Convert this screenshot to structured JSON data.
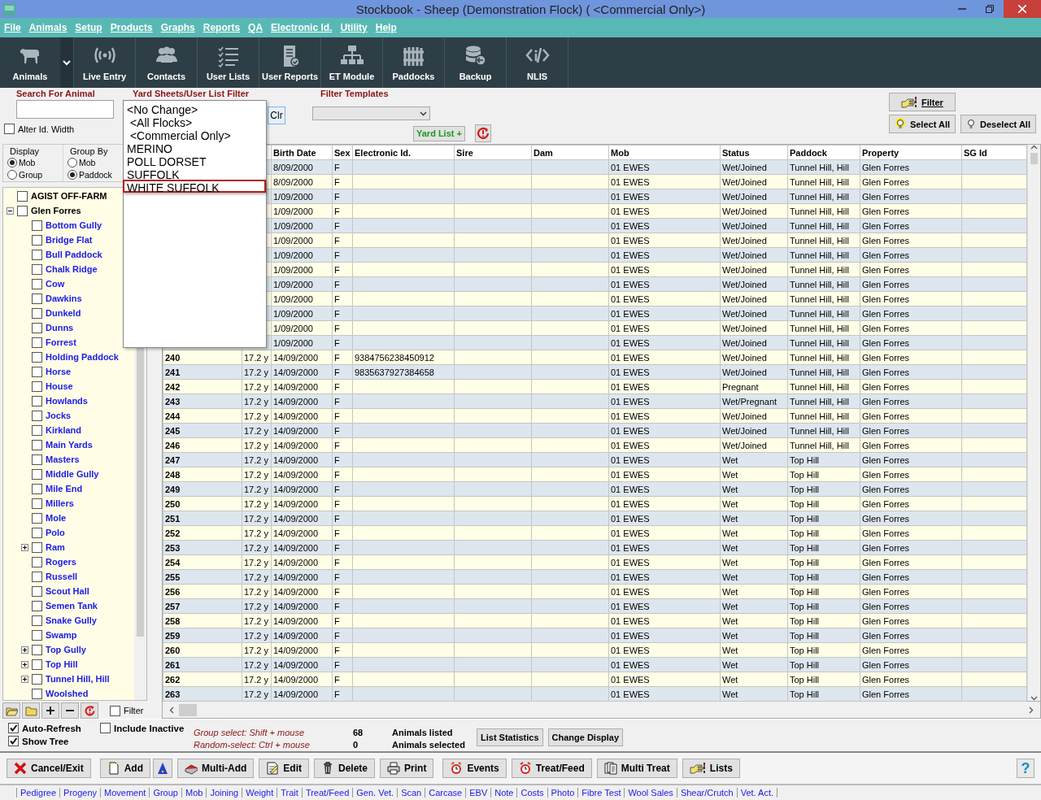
{
  "window": {
    "title": "Stockbook - Sheep (Demonstration Flock) ( <Commercial Only>)"
  },
  "menu": [
    "File",
    "Animals",
    "Setup",
    "Products",
    "Graphs",
    "Reports",
    "QA",
    "Electronic Id.",
    "Utility",
    "Help"
  ],
  "toolbar": [
    {
      "label": "Animals",
      "dropdown": true
    },
    {
      "label": "Live Entry"
    },
    {
      "label": "Contacts"
    },
    {
      "label": "User Lists"
    },
    {
      "label": "User Reports"
    },
    {
      "label": "ET Module"
    },
    {
      "label": "Paddocks"
    },
    {
      "label": "Backup"
    },
    {
      "label": "NLIS"
    }
  ],
  "filters": {
    "search": {
      "label": "Search For Animal"
    },
    "alter_id_width": {
      "label": "Alter Id. Width",
      "checked": false
    },
    "list_filter": {
      "label": "Yard Sheets/User List Filter",
      "clear_button": "Clr",
      "options": [
        {
          "label": "<No Change>",
          "selected": false
        },
        {
          "label": " <All Flocks>",
          "selected": false
        },
        {
          "label": " <Commercial Only>",
          "selected": false
        },
        {
          "label": "MERINO",
          "selected": false
        },
        {
          "label": "POLL DORSET",
          "selected": false
        },
        {
          "label": "SUFFOLK",
          "selected": false
        },
        {
          "label": "WHITE SUFFOLK",
          "selected": true
        }
      ]
    },
    "filter_templates": {
      "label": "Filter Templates"
    },
    "yard_list_button": "Yard List +",
    "filter_button": "Filter",
    "select_all_button": "Select All",
    "deselect_all_button": "Deselect All"
  },
  "display": {
    "label": "Display",
    "options": [
      {
        "label": "Mob",
        "selected": true
      },
      {
        "label": "Group",
        "selected": false
      }
    ]
  },
  "group_by": {
    "label": "Group By",
    "options": [
      {
        "label": "Mob",
        "selected": false
      },
      {
        "label": "Paddock",
        "selected": true
      }
    ]
  },
  "tree": [
    {
      "label": "AGIST OFF-FARM",
      "checked": false
    },
    {
      "label": "Glen Forres",
      "checked": false,
      "expanded": true,
      "children": [
        {
          "label": "Bottom Gully",
          "checked": false
        },
        {
          "label": "Bridge Flat",
          "checked": false
        },
        {
          "label": "Bull Paddock",
          "checked": false
        },
        {
          "label": "Chalk Ridge",
          "checked": false
        },
        {
          "label": "Cow",
          "checked": false
        },
        {
          "label": "Dawkins",
          "checked": false
        },
        {
          "label": "Dunkeld",
          "checked": false
        },
        {
          "label": "Dunns",
          "checked": false
        },
        {
          "label": "Forrest",
          "checked": false
        },
        {
          "label": "Holding Paddock",
          "checked": false
        },
        {
          "label": "Horse",
          "checked": false
        },
        {
          "label": "House",
          "checked": false
        },
        {
          "label": "Howlands",
          "checked": false
        },
        {
          "label": "Jocks",
          "checked": false
        },
        {
          "label": "Kirkland",
          "checked": false
        },
        {
          "label": "Main Yards",
          "checked": false
        },
        {
          "label": "Masters",
          "checked": false
        },
        {
          "label": "Middle Gully",
          "checked": false
        },
        {
          "label": "Mile End",
          "checked": false
        },
        {
          "label": "Millers",
          "checked": false
        },
        {
          "label": "Mole",
          "checked": false
        },
        {
          "label": "Polo",
          "checked": false
        },
        {
          "label": "Ram",
          "checked": false,
          "expanded": false
        },
        {
          "label": "Rogers",
          "checked": false
        },
        {
          "label": "Russell",
          "checked": false
        },
        {
          "label": "Scout Hall",
          "checked": false
        },
        {
          "label": "Semen Tank",
          "checked": false
        },
        {
          "label": "Snake Gully",
          "checked": false
        },
        {
          "label": "Swamp",
          "checked": false
        },
        {
          "label": "Top Gully",
          "checked": false,
          "expanded": false
        },
        {
          "label": "Top Hill",
          "checked": false,
          "expanded": false
        },
        {
          "label": "Tunnel Hill, Hill",
          "checked": false,
          "expanded": false
        },
        {
          "label": "Woolshed",
          "checked": false
        }
      ]
    }
  ],
  "tree_filter": {
    "label": "Filter",
    "checked": false
  },
  "table": {
    "columns": [
      "Birth Date",
      "Sex",
      "Electronic Id.",
      "Sire",
      "Dam",
      "Mob",
      "Status",
      "Paddock",
      "Property",
      "SG Id"
    ],
    "rows": [
      {
        "birth_date": "8/09/2000",
        "sex": "F",
        "mob": "01 EWES",
        "status": "Wet/Joined",
        "paddock": "Tunnel Hill, Hill",
        "property": "Glen Forres"
      },
      {
        "birth_date": "8/09/2000",
        "sex": "F",
        "mob": "01 EWES",
        "status": "Wet/Joined",
        "paddock": "Tunnel Hill, Hill",
        "property": "Glen Forres"
      },
      {
        "birth_date": "1/09/2000",
        "sex": "F",
        "mob": "01 EWES",
        "status": "Wet/Joined",
        "paddock": "Tunnel Hill, Hill",
        "property": "Glen Forres"
      },
      {
        "birth_date": "1/09/2000",
        "sex": "F",
        "mob": "01 EWES",
        "status": "Wet/Joined",
        "paddock": "Tunnel Hill, Hill",
        "property": "Glen Forres"
      },
      {
        "birth_date": "1/09/2000",
        "sex": "F",
        "mob": "01 EWES",
        "status": "Wet/Joined",
        "paddock": "Tunnel Hill, Hill",
        "property": "Glen Forres"
      },
      {
        "birth_date": "1/09/2000",
        "sex": "F",
        "mob": "01 EWES",
        "status": "Wet/Joined",
        "paddock": "Tunnel Hill, Hill",
        "property": "Glen Forres"
      },
      {
        "birth_date": "1/09/2000",
        "sex": "F",
        "mob": "01 EWES",
        "status": "Wet/Joined",
        "paddock": "Tunnel Hill, Hill",
        "property": "Glen Forres"
      },
      {
        "birth_date": "1/09/2000",
        "sex": "F",
        "mob": "01 EWES",
        "status": "Wet/Joined",
        "paddock": "Tunnel Hill, Hill",
        "property": "Glen Forres"
      },
      {
        "birth_date": "1/09/2000",
        "sex": "F",
        "mob": "01 EWES",
        "status": "Wet/Joined",
        "paddock": "Tunnel Hill, Hill",
        "property": "Glen Forres"
      },
      {
        "birth_date": "1/09/2000",
        "sex": "F",
        "mob": "01 EWES",
        "status": "Wet/Joined",
        "paddock": "Tunnel Hill, Hill",
        "property": "Glen Forres"
      },
      {
        "birth_date": "1/09/2000",
        "sex": "F",
        "mob": "01 EWES",
        "status": "Wet/Joined",
        "paddock": "Tunnel Hill, Hill",
        "property": "Glen Forres"
      },
      {
        "birth_date": "1/09/2000",
        "sex": "F",
        "mob": "01 EWES",
        "status": "Wet/Joined",
        "paddock": "Tunnel Hill, Hill",
        "property": "Glen Forres"
      },
      {
        "birth_date": "1/09/2000",
        "sex": "F",
        "mob": "01 EWES",
        "status": "Wet/Joined",
        "paddock": "Tunnel Hill, Hill",
        "property": "Glen Forres"
      },
      {
        "id": "240",
        "age": "17.2 y",
        "birth_date": "14/09/2000",
        "sex": "F",
        "electronic_id": "9384756238450912",
        "mob": "01 EWES",
        "status": "Wet/Joined",
        "paddock": "Tunnel Hill, Hill",
        "property": "Glen Forres"
      },
      {
        "id": "241",
        "age": "17.2 y",
        "birth_date": "14/09/2000",
        "sex": "F",
        "electronic_id": "9835637927384658",
        "mob": "01 EWES",
        "status": "Wet/Joined",
        "paddock": "Tunnel Hill, Hill",
        "property": "Glen Forres"
      },
      {
        "id": "242",
        "age": "17.2 y",
        "birth_date": "14/09/2000",
        "sex": "F",
        "mob": "01 EWES",
        "status": "Pregnant",
        "paddock": "Tunnel Hill, Hill",
        "property": "Glen Forres"
      },
      {
        "id": "243",
        "age": "17.2 y",
        "birth_date": "14/09/2000",
        "sex": "F",
        "mob": "01 EWES",
        "status": "Wet/Pregnant",
        "paddock": "Tunnel Hill, Hill",
        "property": "Glen Forres"
      },
      {
        "id": "244",
        "age": "17.2 y",
        "birth_date": "14/09/2000",
        "sex": "F",
        "mob": "01 EWES",
        "status": "Wet/Joined",
        "paddock": "Tunnel Hill, Hill",
        "property": "Glen Forres"
      },
      {
        "id": "245",
        "age": "17.2 y",
        "birth_date": "14/09/2000",
        "sex": "F",
        "mob": "01 EWES",
        "status": "Wet/Joined",
        "paddock": "Tunnel Hill, Hill",
        "property": "Glen Forres"
      },
      {
        "id": "246",
        "age": "17.2 y",
        "birth_date": "14/09/2000",
        "sex": "F",
        "mob": "01 EWES",
        "status": "Wet/Joined",
        "paddock": "Tunnel Hill, Hill",
        "property": "Glen Forres"
      },
      {
        "id": "247",
        "age": "17.2 y",
        "birth_date": "14/09/2000",
        "sex": "F",
        "mob": "01 EWES",
        "status": "Wet",
        "paddock": "Top Hill",
        "property": "Glen Forres"
      },
      {
        "id": "248",
        "age": "17.2 y",
        "birth_date": "14/09/2000",
        "sex": "F",
        "mob": "01 EWES",
        "status": "Wet",
        "paddock": "Top Hill",
        "property": "Glen Forres"
      },
      {
        "id": "249",
        "age": "17.2 y",
        "birth_date": "14/09/2000",
        "sex": "F",
        "mob": "01 EWES",
        "status": "Wet",
        "paddock": "Top Hill",
        "property": "Glen Forres"
      },
      {
        "id": "250",
        "age": "17.2 y",
        "birth_date": "14/09/2000",
        "sex": "F",
        "mob": "01 EWES",
        "status": "Wet",
        "paddock": "Top Hill",
        "property": "Glen Forres"
      },
      {
        "id": "251",
        "age": "17.2 y",
        "birth_date": "14/09/2000",
        "sex": "F",
        "mob": "01 EWES",
        "status": "Wet",
        "paddock": "Top Hill",
        "property": "Glen Forres"
      },
      {
        "id": "252",
        "age": "17.2 y",
        "birth_date": "14/09/2000",
        "sex": "F",
        "mob": "01 EWES",
        "status": "Wet",
        "paddock": "Top Hill",
        "property": "Glen Forres"
      },
      {
        "id": "253",
        "age": "17.2 y",
        "birth_date": "14/09/2000",
        "sex": "F",
        "mob": "01 EWES",
        "status": "Wet",
        "paddock": "Top Hill",
        "property": "Glen Forres"
      },
      {
        "id": "254",
        "age": "17.2 y",
        "birth_date": "14/09/2000",
        "sex": "F",
        "mob": "01 EWES",
        "status": "Wet",
        "paddock": "Top Hill",
        "property": "Glen Forres"
      },
      {
        "id": "255",
        "age": "17.2 y",
        "birth_date": "14/09/2000",
        "sex": "F",
        "mob": "01 EWES",
        "status": "Wet",
        "paddock": "Top Hill",
        "property": "Glen Forres"
      },
      {
        "id": "256",
        "age": "17.2 y",
        "birth_date": "14/09/2000",
        "sex": "F",
        "mob": "01 EWES",
        "status": "Wet",
        "paddock": "Top Hill",
        "property": "Glen Forres"
      },
      {
        "id": "257",
        "age": "17.2 y",
        "birth_date": "14/09/2000",
        "sex": "F",
        "mob": "01 EWES",
        "status": "Wet",
        "paddock": "Top Hill",
        "property": "Glen Forres"
      },
      {
        "id": "258",
        "age": "17.2 y",
        "birth_date": "14/09/2000",
        "sex": "F",
        "mob": "01 EWES",
        "status": "Wet",
        "paddock": "Top Hill",
        "property": "Glen Forres"
      },
      {
        "id": "259",
        "age": "17.2 y",
        "birth_date": "14/09/2000",
        "sex": "F",
        "mob": "01 EWES",
        "status": "Wet",
        "paddock": "Top Hill",
        "property": "Glen Forres"
      },
      {
        "id": "260",
        "age": "17.2 y",
        "birth_date": "14/09/2000",
        "sex": "F",
        "mob": "01 EWES",
        "status": "Wet",
        "paddock": "Top Hill",
        "property": "Glen Forres"
      },
      {
        "id": "261",
        "age": "17.2 y",
        "birth_date": "14/09/2000",
        "sex": "F",
        "mob": "01 EWES",
        "status": "Wet",
        "paddock": "Top Hill",
        "property": "Glen Forres"
      },
      {
        "id": "262",
        "age": "17.2 y",
        "birth_date": "14/09/2000",
        "sex": "F",
        "mob": "01 EWES",
        "status": "Wet",
        "paddock": "Top Hill",
        "property": "Glen Forres"
      },
      {
        "id": "263",
        "age": "17.2 y",
        "birth_date": "14/09/2000",
        "sex": "F",
        "mob": "01 EWES",
        "status": "Wet",
        "paddock": "Top Hill",
        "property": "Glen Forres"
      }
    ]
  },
  "status": {
    "auto_refresh": {
      "label": "Auto-Refresh",
      "checked": true
    },
    "show_tree": {
      "label": "Show Tree",
      "checked": true
    },
    "include_inactive": {
      "label": "Include Inactive",
      "checked": false
    },
    "hints": [
      "Group select: Shift + mouse",
      "Random-select: Ctrl + mouse"
    ],
    "counts": [
      {
        "value": "68",
        "label": "Animals listed"
      },
      {
        "value": "0",
        "label": "Animals selected"
      }
    ],
    "buttons": [
      "List Statistics",
      "Change Display"
    ]
  },
  "actions": [
    {
      "kind": "text",
      "label": "Cancel/Exit"
    },
    {
      "kind": "text",
      "label": "Add"
    },
    {
      "kind": "icon"
    },
    {
      "kind": "text",
      "label": "Multi-Add"
    },
    {
      "kind": "text",
      "label": "Edit"
    },
    {
      "kind": "text",
      "label": "Delete"
    },
    {
      "kind": "text",
      "label": "Print"
    },
    {
      "kind": "text",
      "label": "Events"
    },
    {
      "kind": "text",
      "label": "Treat/Feed"
    },
    {
      "kind": "text",
      "label": "Multi Treat"
    },
    {
      "kind": "text",
      "label": "Lists"
    }
  ],
  "help_button": "?",
  "links": [
    "Pedigree",
    "Progeny",
    "Movement",
    "Group",
    "Mob",
    "Joining",
    "Weight",
    "Trait",
    "Treat/Feed",
    "Gen. Vet.",
    "Scan",
    "Carcase",
    "EBV",
    "Note",
    "Costs",
    "Photo",
    "Fibre Test",
    "Wool Sales",
    "Shear/Crutch",
    "Vet. Act."
  ]
}
